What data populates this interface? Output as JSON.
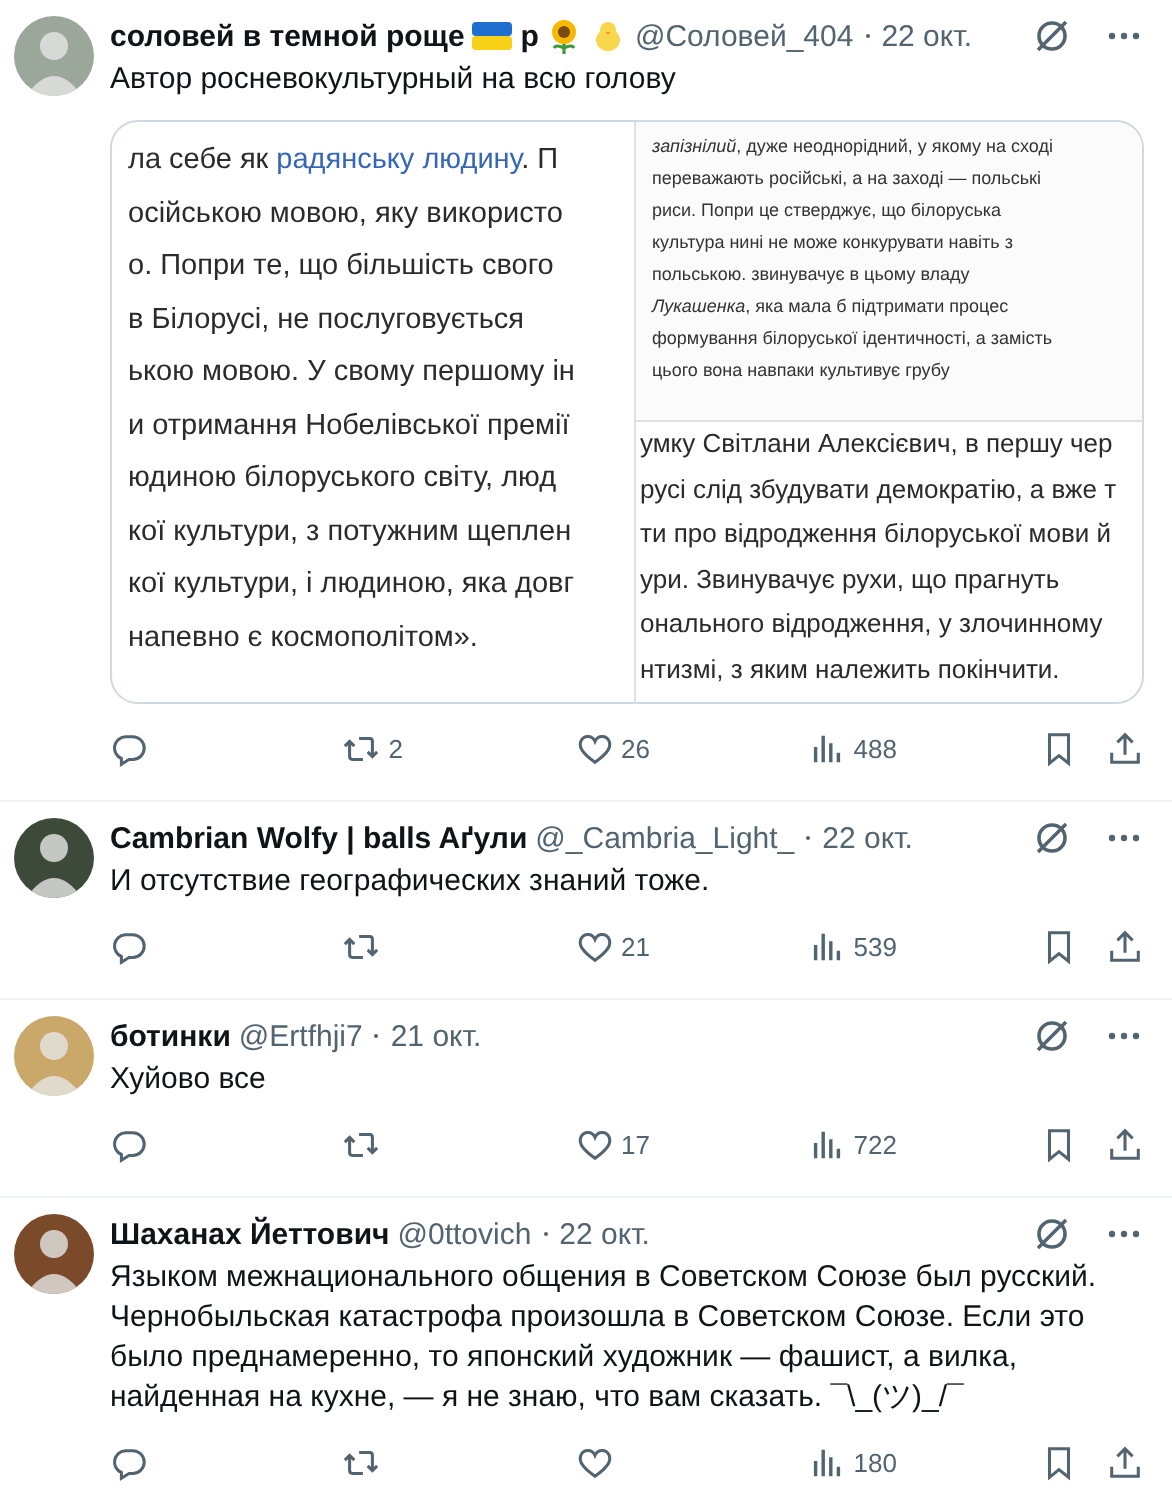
{
  "tweets": [
    {
      "name_parts": [
        {
          "kind": "text",
          "text": "соловей в темной роще"
        },
        {
          "kind": "flag"
        },
        {
          "kind": "text",
          "text": "р"
        },
        {
          "kind": "sunflower"
        },
        {
          "kind": "chick"
        }
      ],
      "handle": "@Соловей_404",
      "date": "22 окт.",
      "text": "Автор росневокультурный на всю голову",
      "image": {
        "kind": "document-collage",
        "left_lines": [
          {
            "text": "ла себе як ",
            "link": "радянську людину",
            "after": ". П"
          },
          {
            "text": "осійською мовою, яку використо"
          },
          {
            "text": "о. Попри те, що більшість свого"
          },
          {
            "text": "в Білорусі, не послуговується"
          },
          {
            "text": "ькою мовою. У свому першому ін"
          },
          {
            "text": "и отримання Нобелівської премії"
          },
          {
            "text": "юдиною білоруського світу, люд"
          },
          {
            "text": "кої культури, з потужним щеплен"
          },
          {
            "text": "кої культури, і людиною, яка довг"
          },
          {
            "text": "напевно є космополітом»."
          }
        ],
        "note_lines": [
          "*запізнілий*, дуже неоднорідний, у якому на сході",
          "переважають російські, а на заході — польські",
          "риси. Попри це стверджує, що білоруська",
          "культура нині не може конкурувати навіть з",
          "польською. звинувачує в цьому владу",
          "*Лукашенка*, яка мала б підтримати процес",
          "формування білоруської ідентичності, а замість",
          "цього вона навпаки культивує грубу"
        ],
        "right_lines": [
          "умку Світлани Алексієвич, в першу чер",
          "русі слід збудувати демократію, а вже т",
          "ти про відродження білоруської мови й",
          "ури. Звинувачує рухи, що прагнуть",
          "онального відродження, у злочинному",
          "нтизмі, з яким належить покінчити."
        ]
      },
      "actions": [
        {
          "kind": "reply"
        },
        {
          "kind": "repost",
          "count": "2"
        },
        {
          "kind": "like",
          "count": "26"
        },
        {
          "kind": "views",
          "count": "488"
        },
        {
          "kind": "bookmark"
        },
        {
          "kind": "share"
        }
      ]
    },
    {
      "name_parts": [
        {
          "kind": "text",
          "text": "Cambrian Wolfy | balls Aґули"
        }
      ],
      "handle": "@_Cambria_Light_",
      "date": "22 окт.",
      "text": "И отсутствие географических знаний тоже.",
      "actions": [
        {
          "kind": "reply"
        },
        {
          "kind": "repost"
        },
        {
          "kind": "like",
          "count": "21"
        },
        {
          "kind": "views",
          "count": "539"
        },
        {
          "kind": "bookmark"
        },
        {
          "kind": "share"
        }
      ]
    },
    {
      "name_parts": [
        {
          "kind": "text",
          "text": "ботинки"
        }
      ],
      "handle": "@Ertfhji7",
      "date": "21 окт.",
      "text": "Хуйово все",
      "actions": [
        {
          "kind": "reply"
        },
        {
          "kind": "repost"
        },
        {
          "kind": "like",
          "count": "17"
        },
        {
          "kind": "views",
          "count": "722"
        },
        {
          "kind": "bookmark"
        },
        {
          "kind": "share"
        }
      ]
    },
    {
      "name_parts": [
        {
          "kind": "text",
          "text": "Шаханах Йеттович"
        }
      ],
      "handle": "@0ttovich",
      "date": "22 окт.",
      "text": "Языком межнационального общения в Советском Союзе был русский. Чернобыльская катастрофа произошла в Советском Союзе. Если это было преднамеренно, то японский художник — фашист, а вилка, найденная на кухне, — я не знаю, что вам сказать. ¯\\_(ツ)_/¯",
      "actions": [
        {
          "kind": "reply"
        },
        {
          "kind": "repost"
        },
        {
          "kind": "like"
        },
        {
          "kind": "views",
          "count": "180"
        },
        {
          "kind": "bookmark"
        },
        {
          "kind": "share"
        }
      ]
    }
  ]
}
